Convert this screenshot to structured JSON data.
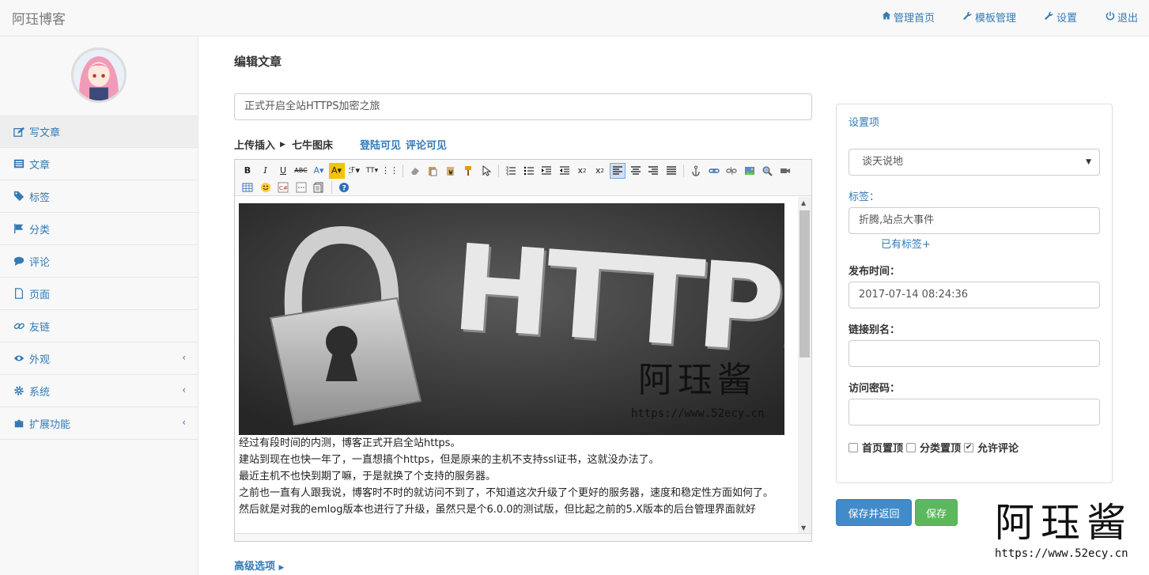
{
  "brand": "阿珏博客",
  "topnav": [
    {
      "label": "管理首页",
      "icon": "home-icon"
    },
    {
      "label": "模板管理",
      "icon": "wrench-icon"
    },
    {
      "label": "设置",
      "icon": "wrench-icon"
    },
    {
      "label": "退出",
      "icon": "power-icon"
    }
  ],
  "sidebar": {
    "items": [
      {
        "label": "写文章",
        "icon": "edit-icon",
        "active": true
      },
      {
        "label": "文章",
        "icon": "list-icon"
      },
      {
        "label": "标签",
        "icon": "tags-icon"
      },
      {
        "label": "分类",
        "icon": "flag-icon"
      },
      {
        "label": "评论",
        "icon": "comments-icon"
      },
      {
        "label": "页面",
        "icon": "file-icon"
      },
      {
        "label": "友链",
        "icon": "link-icon"
      },
      {
        "label": "外观",
        "icon": "eye-icon",
        "chevron": "‹"
      },
      {
        "label": "系统",
        "icon": "gear-icon",
        "chevron": "‹"
      },
      {
        "label": "扩展功能",
        "icon": "puzzle-icon",
        "chevron": "‹"
      }
    ]
  },
  "main": {
    "page_title": "编辑文章",
    "post_title": "正式开启全站HTTPS加密之旅",
    "upload_label": "上传插入",
    "qiniu_label": "七牛图床",
    "login_visible": "登陆可见",
    "comment_visible": "评论可见",
    "advanced": "高级选项",
    "image_text": {
      "big": "HTTPS",
      "wm_name": "阿珏酱",
      "wm_url": "https://www.52ecy.cn"
    },
    "paragraphs": [
      "经过有段时间的内测，博客正式开启全站https。",
      "建站到现在也快一年了，一直想搞个https，但是原来的主机不支持ssl证书，这就没办法了。",
      "最近主机不也快到期了嘛，于是就换了个支持的服务器。",
      "之前也一直有人跟我说，博客时不时的就访问不到了，不知道这次升级了个更好的服务器，速度和稳定性方面如何了。",
      "然后就是对我的emlog版本也进行了升级，虽然只是个6.0.0的测试版，但比起之前的5.X版本的后台管理界面就好"
    ]
  },
  "settings": {
    "heading": "设置项",
    "category": "谈天说地",
    "tags_label": "标签：",
    "tags_value": "折腾,站点大事件",
    "existing_tags": "已有标签+",
    "date_label": "发布时间：",
    "date_value": "2017-07-14 08:24:36",
    "alias_label": "链接别名：",
    "alias_value": "",
    "password_label": "访问密码：",
    "password_value": "",
    "checkboxes": [
      {
        "label": "首页置顶",
        "checked": false
      },
      {
        "label": "分类置顶",
        "checked": false
      },
      {
        "label": "允许评论",
        "checked": true
      }
    ],
    "save_return": "保存并返回",
    "save": "保存"
  },
  "watermark": {
    "name": "阿珏酱",
    "url": "https://www.52ecy.cn"
  },
  "colors": {
    "link": "#337ab7",
    "primary": "#428bca",
    "success": "#5cb85c"
  }
}
